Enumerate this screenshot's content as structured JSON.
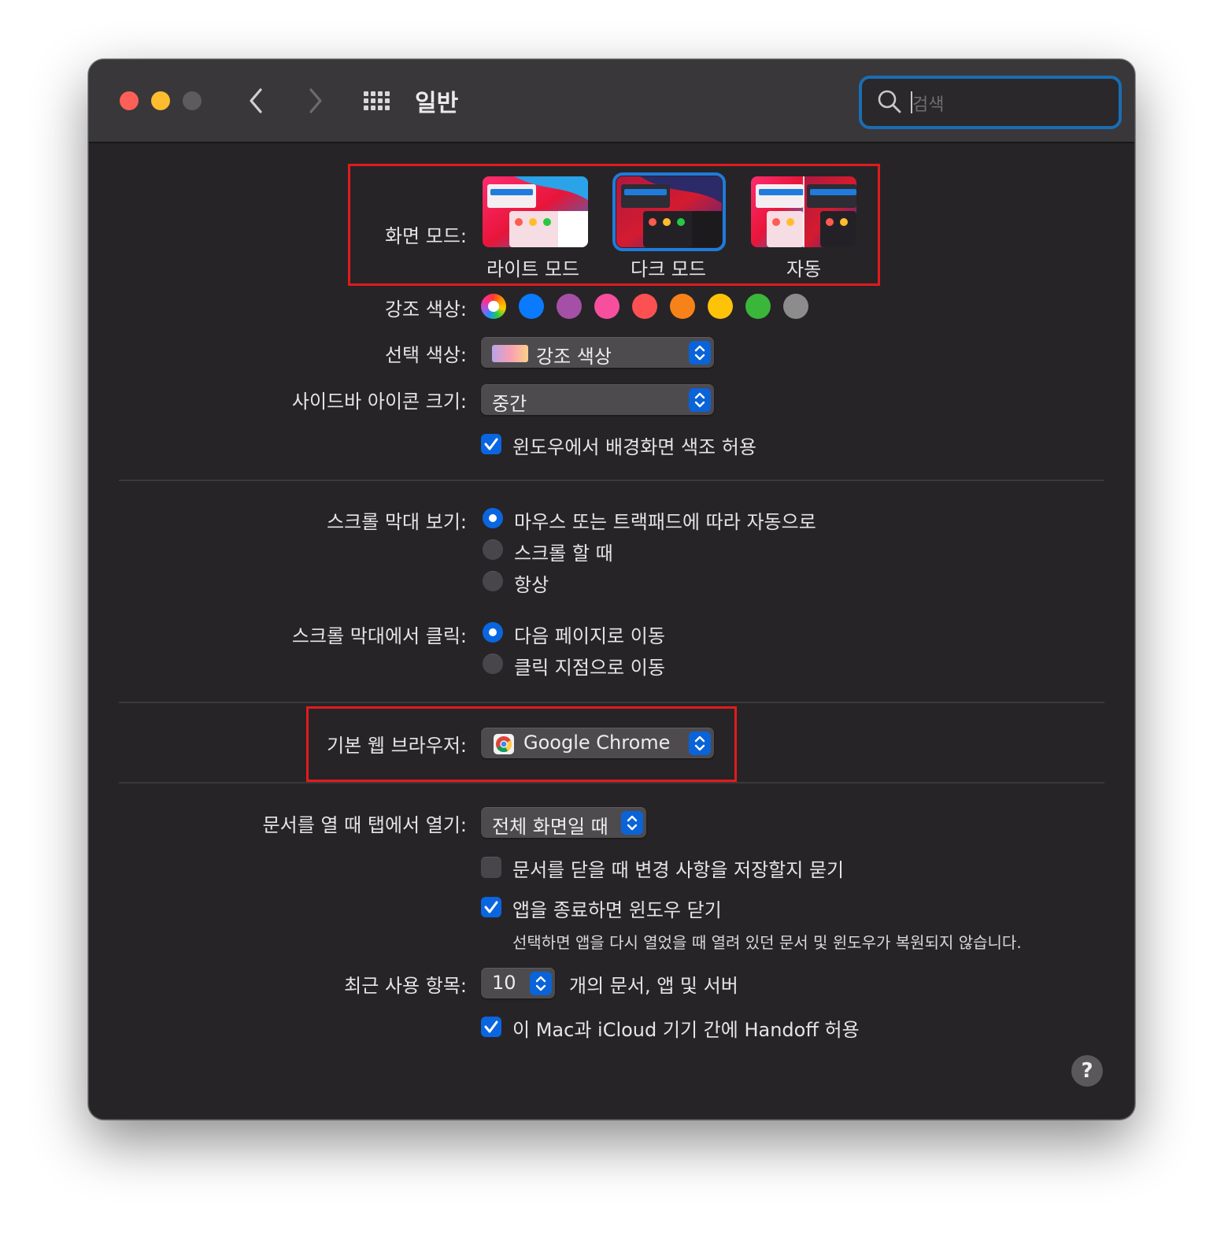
{
  "window": {
    "title": "일반",
    "search_placeholder": "검색"
  },
  "appearance": {
    "label": "화면 모드:",
    "options": [
      {
        "label": "라이트 모드",
        "selected": false
      },
      {
        "label": "다크 모드",
        "selected": true
      },
      {
        "label": "자동",
        "selected": false
      }
    ]
  },
  "accent": {
    "label": "강조 색상:",
    "colors": [
      "multicolor",
      "#0a7aff",
      "#a550a7",
      "#f74f9e",
      "#fc5053",
      "#f8821a",
      "#fec309",
      "#3ab63a",
      "#8c8c8c"
    ]
  },
  "highlight": {
    "label": "선택 색상:",
    "value": "강조 색상"
  },
  "sidebar_icon": {
    "label": "사이드바 아이콘 크기:",
    "value": "중간"
  },
  "wallpaper_tint": {
    "label": "윈도우에서 배경화면 색조 허용",
    "checked": true
  },
  "scrollbars": {
    "label": "스크롤 막대 보기:",
    "options": [
      {
        "label": "마우스 또는 트랙패드에 따라 자동으로",
        "selected": true
      },
      {
        "label": "스크롤 할 때",
        "selected": false
      },
      {
        "label": "항상",
        "selected": false
      }
    ]
  },
  "scroll_click": {
    "label": "스크롤 막대에서 클릭:",
    "options": [
      {
        "label": "다음 페이지로 이동",
        "selected": true
      },
      {
        "label": "클릭 지점으로 이동",
        "selected": false
      }
    ]
  },
  "browser": {
    "label": "기본 웹 브라우저:",
    "value": "Google Chrome"
  },
  "tabs": {
    "label": "문서를 열 때 탭에서 열기:",
    "value": "전체 화면일 때"
  },
  "ask_save": {
    "label": "문서를 닫을 때 변경 사항을 저장할지 묻기",
    "checked": false
  },
  "close_windows": {
    "label": "앱을 종료하면 윈도우 닫기",
    "checked": true,
    "note": "선택하면 앱을 다시 열었을 때 열려 있던 문서 및 윈도우가 복원되지 않습니다."
  },
  "recent": {
    "label": "최근 사용 항목:",
    "value": "10",
    "suffix": "개의 문서, 앱 및 서버"
  },
  "handoff": {
    "label": "이 Mac과 iCloud 기기 간에 Handoff 허용",
    "checked": true
  },
  "help": "?"
}
